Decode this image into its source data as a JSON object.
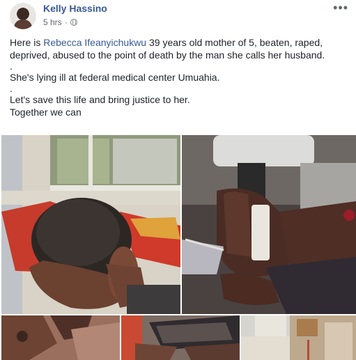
{
  "post": {
    "author": "Kelly Hassino",
    "timestamp": "5 hrs",
    "separator": "·",
    "more_label": "•••",
    "text": {
      "line1_pre": "Here is ",
      "mention": "Rebecca Ifeanyichukwu",
      "line1_post": " 39 years old mother of 5, beaten, raped, deprived, abused to the point of death by the man she calls her husband.",
      "dot1": ".",
      "line2": "She's lying ill at federal medical center Umuahia.",
      "dot2": ".",
      "line3": "Let's save this life and bring justice to her.",
      "line4": "Together we can"
    }
  },
  "icons": {
    "privacy": "globe-icon",
    "menu": "more-options-icon"
  },
  "colors": {
    "author": "#385898",
    "text": "#1d2129",
    "meta": "#616770"
  }
}
